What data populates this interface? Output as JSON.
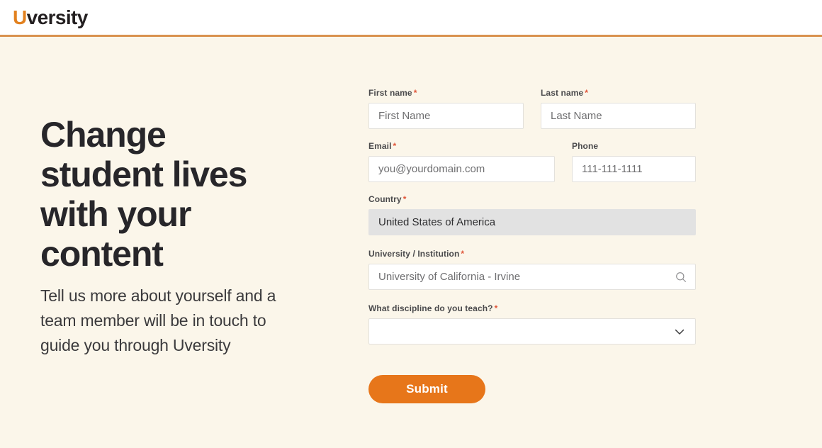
{
  "header": {
    "brand_u": "U",
    "brand_rest": "versity",
    "accent_color": "#e2811f",
    "divider_color": "#d9924f"
  },
  "theme": {
    "page_background": "#fbf6ea",
    "text_dark": "#27262a",
    "required_marker_color": "#e0563a",
    "submit_color": "#e7761a"
  },
  "hero": {
    "title": "Change student lives with your content",
    "subtitle": "Tell us more about yourself and a team member will be in touch to guide you through Uversity"
  },
  "form": {
    "required_marker": "*",
    "fields": {
      "first_name": {
        "label": "First name",
        "required": true,
        "placeholder": "First Name",
        "value": ""
      },
      "last_name": {
        "label": "Last name",
        "required": true,
        "placeholder": "Last Name",
        "value": ""
      },
      "email": {
        "label": "Email",
        "required": true,
        "placeholder": "you@yourdomain.com",
        "value": ""
      },
      "phone": {
        "label": "Phone",
        "required": false,
        "placeholder": "111-111-1111",
        "value": ""
      },
      "country": {
        "label": "Country",
        "required": true,
        "value": "United States of America",
        "readonly": true
      },
      "university": {
        "label": "University / Institution",
        "required": true,
        "placeholder": "University of California - Irvine",
        "value": "",
        "icon": "search-icon"
      },
      "discipline": {
        "label": "What discipline do you teach?",
        "required": true,
        "value": "",
        "icon": "chevron-down-icon",
        "options": [
          ""
        ]
      }
    },
    "submit_label": "Submit"
  }
}
